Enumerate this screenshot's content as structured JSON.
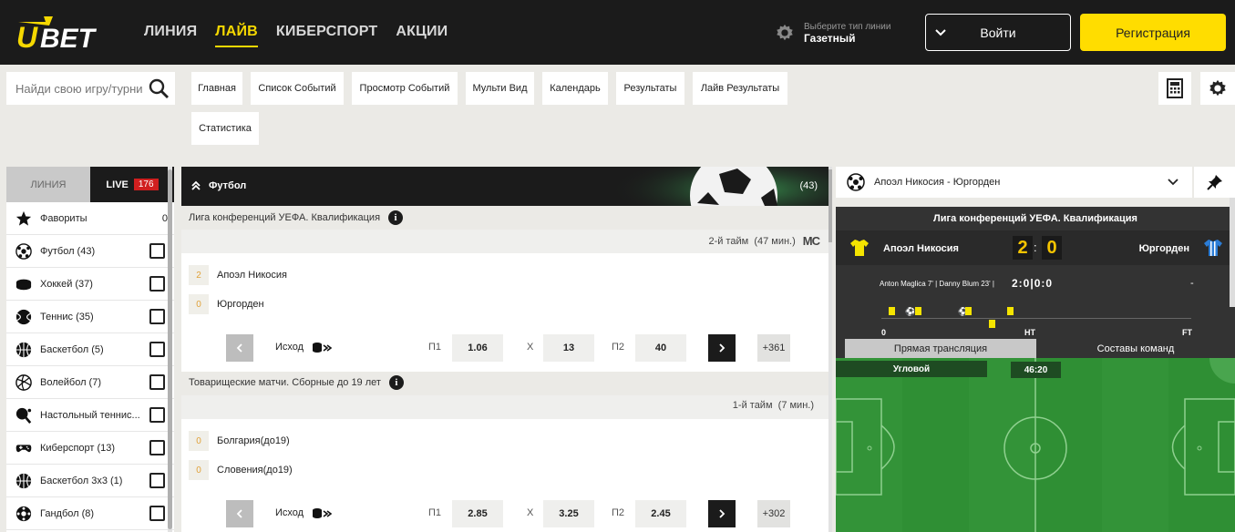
{
  "header": {
    "logo_text": "UBET",
    "nav": [
      "ЛИНИЯ",
      "ЛАЙВ",
      "КИБЕРСПОРТ",
      "АКЦИИ"
    ],
    "nav_active_index": 1,
    "line_type_hint": "Выберите тип линии",
    "line_type_value": "Газетный",
    "login_label": "Войти",
    "register_label": "Регистрация"
  },
  "search": {
    "placeholder": "Найди свою игру/турнир"
  },
  "tabs": [
    "Главная",
    "Список Событий",
    "Просмотр Событий",
    "Мульти Вид",
    "Календарь",
    "Результаты",
    "Лайв Результаты",
    "Статистика"
  ],
  "left_panel": {
    "tab_line": "ЛИНИЯ",
    "tab_live": "LIVE",
    "live_count": "176",
    "favorites_label": "Фавориты",
    "favorites_count": "0",
    "sports": [
      {
        "label": "Футбол (43)",
        "icon": "football-icon"
      },
      {
        "label": "Хоккей (37)",
        "icon": "hockey-puck-icon"
      },
      {
        "label": "Теннис (35)",
        "icon": "tennis-ball-icon"
      },
      {
        "label": "Баскетбол (5)",
        "icon": "basketball-icon"
      },
      {
        "label": "Волейбол (7)",
        "icon": "volleyball-icon"
      },
      {
        "label": "Настольный теннис...",
        "icon": "table-tennis-icon"
      },
      {
        "label": "Киберспорт (13)",
        "icon": "gamepad-icon"
      },
      {
        "label": "Баскетбол 3x3 (1)",
        "icon": "basketball-icon"
      },
      {
        "label": "Гандбол (8)",
        "icon": "handball-icon"
      }
    ]
  },
  "center": {
    "sport_title": "Футбол",
    "sport_count": "(43)",
    "events": [
      {
        "league": "Лига конференций УЕФА. Квалификация",
        "status": "2-й тайм",
        "minute": "(47 мин.)",
        "tracker": "MC",
        "home": {
          "score": "2",
          "name": "Апоэл Никосия"
        },
        "away": {
          "score": "0",
          "name": "Юргорден"
        },
        "market": "Исход",
        "p1_label": "П1",
        "p1": "1.06",
        "x_label": "X",
        "x": "13",
        "p2_label": "П2",
        "p2": "40",
        "more": "+361"
      },
      {
        "league": "Товарищеские матчи. Сборные до 19 лет",
        "status": "1-й тайм",
        "minute": "(7 мин.)",
        "tracker": "",
        "home": {
          "score": "0",
          "name": "Болгария(до19)"
        },
        "away": {
          "score": "0",
          "name": "Словения(до19)"
        },
        "market": "Исход",
        "p1_label": "П1",
        "p1": "2.85",
        "x_label": "X",
        "x": "3.25",
        "p2_label": "П2",
        "p2": "2.45",
        "more": "+302"
      }
    ]
  },
  "right_panel": {
    "match_select": "Апоэл Никосия - Юргорден",
    "league": "Лига конференций УЕФА. Квалификация",
    "home": "Апоэл Никосия",
    "away": "Юргорден",
    "home_score": "2",
    "away_score": "0",
    "scorers": "Anton Maglica 7' | Danny Blum 23' |",
    "period_scores": "2:0|0:0",
    "away_scorers": "-",
    "timeline_start": "0",
    "timeline_ht": "HT",
    "timeline_ft": "FT",
    "tab_stream": "Прямая трансляция",
    "tab_lineups": "Составы команд",
    "pitch_event": "Угловой",
    "pitch_time": "46:20"
  },
  "colors": {
    "accent_yellow": "#ffdd00",
    "header_bg": "#1b1b1b",
    "live_red": "#d01f1f",
    "pitch_green": "#2f8f34"
  }
}
